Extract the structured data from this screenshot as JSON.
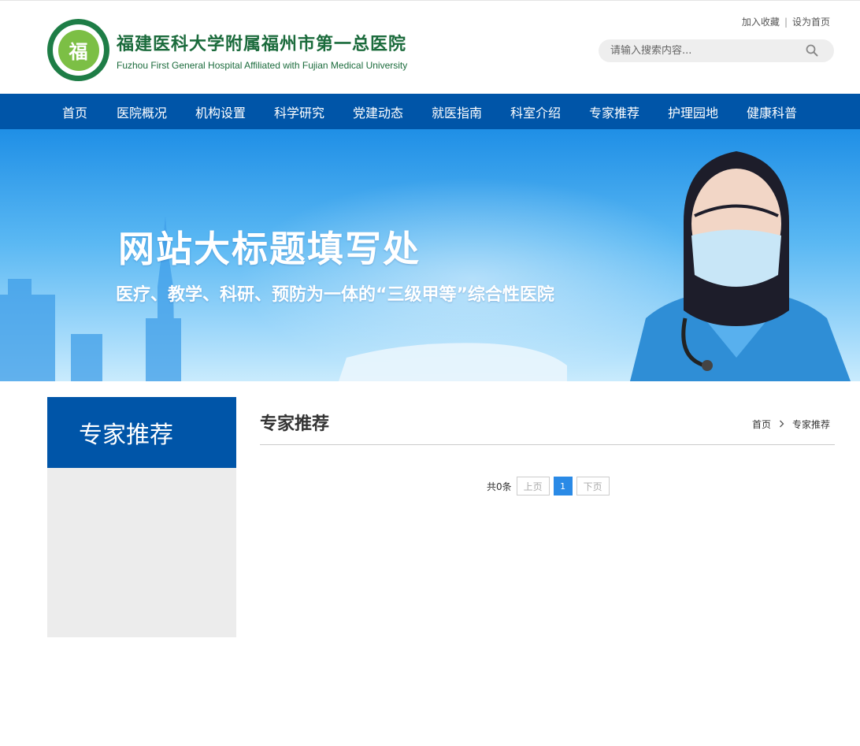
{
  "header": {
    "logo_emblem_char": "福",
    "logo_cn": "福建医科大学附属福州市第一总医院",
    "logo_en": "Fuzhou First General Hospital Affiliated with Fujian Medical University",
    "links": {
      "favorite": "加入收藏",
      "separator": "|",
      "homepage": "设为首页"
    },
    "search": {
      "placeholder": "请输入搜索内容..."
    }
  },
  "nav": {
    "items": [
      "首页",
      "医院概况",
      "机构设置",
      "科学研究",
      "党建动态",
      "就医指南",
      "科室介绍",
      "专家推荐",
      "护理园地",
      "健康科普"
    ]
  },
  "banner": {
    "title": "网站大标题填写处",
    "subtitle": "医疗、教学、科研、预防为一体的“三级甲等”综合性医院"
  },
  "sidebar": {
    "heading": "专家推荐"
  },
  "main": {
    "title": "专家推荐",
    "breadcrumb": {
      "home": "首页",
      "current": "专家推荐"
    },
    "pager": {
      "total": "共0条",
      "prev": "上页",
      "current": "1",
      "next": "下页"
    }
  },
  "colors": {
    "primary": "#0055a8",
    "logo_green": "#1b6b3c",
    "pager_active": "#2a8ae6"
  },
  "icons": {
    "search": "search-icon",
    "breadcrumb_sep": "chevron-right-icon"
  }
}
